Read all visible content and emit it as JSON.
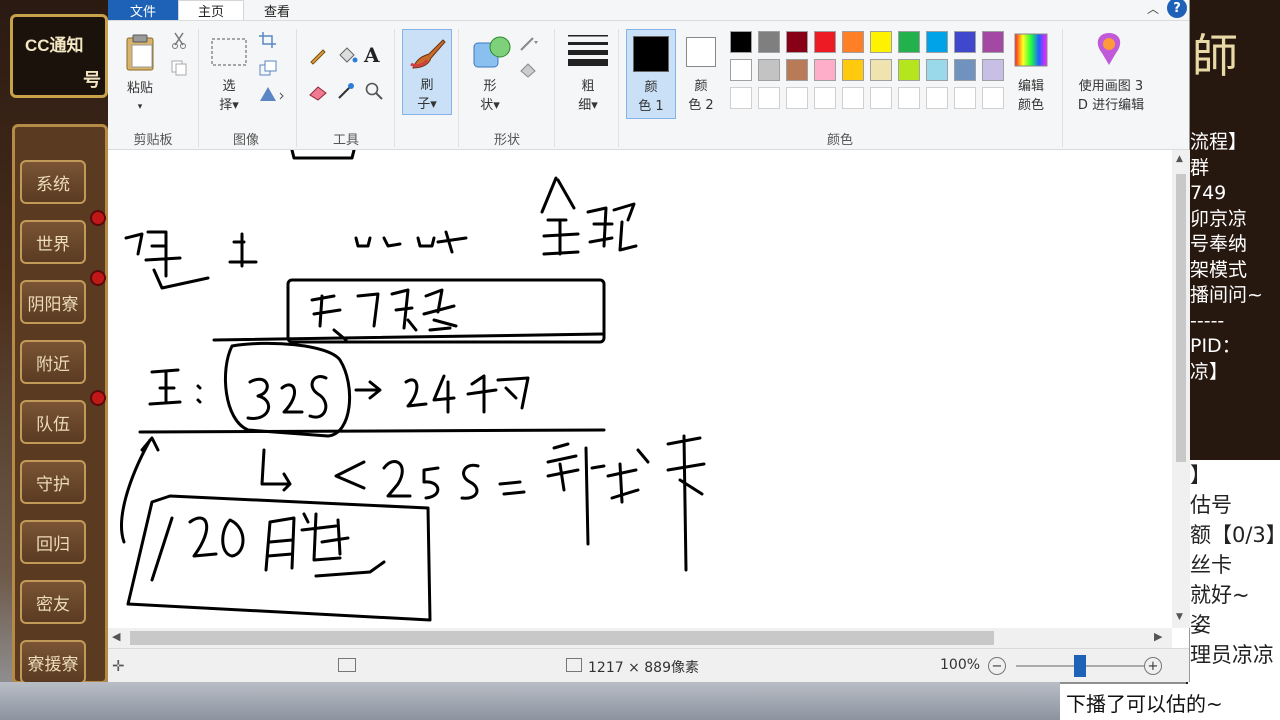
{
  "game": {
    "banner_title": "CC通知",
    "banner_sub": "号",
    "menu": [
      "系统",
      "世界",
      "阴阳寮",
      "附近",
      "队伍",
      "守护",
      "回归",
      "密友",
      "寮援寮"
    ],
    "right_title": "師",
    "right_lines": [
      "流程】",
      "群",
      "749",
      "卯京凉",
      "号奉纳",
      "架模式",
      "播间问~",
      "-----",
      "PID：",
      "凉】"
    ],
    "chat_lines": [
      "】",
      "估号",
      "额【0/3】",
      "丝卡",
      "就好~",
      "姿",
      "理员凉凉"
    ],
    "bottom_tip": "下播了可以估的~"
  },
  "paint": {
    "tabs": {
      "file": "文件",
      "home": "主页",
      "view": "查看"
    },
    "groups": {
      "clipboard": "剪贴板",
      "image": "图像",
      "tools": "工具",
      "shapes": "形状",
      "colors": "颜色"
    },
    "buttons": {
      "paste": [
        "粘贴",
        "▾"
      ],
      "select": [
        "选",
        "择▾"
      ],
      "brush": [
        "刷",
        "子▾"
      ],
      "shape": [
        "形",
        "状▾"
      ],
      "size": [
        "粗",
        "细▾"
      ],
      "color1": [
        "颜",
        "色 1"
      ],
      "color2": [
        "颜",
        "色 2"
      ],
      "edit_colors": [
        "编辑",
        "颜色"
      ],
      "paint3d": [
        "使用画图 3",
        "D 进行编辑"
      ]
    },
    "palette_row1": [
      "#000000",
      "#7f7f7f",
      "#880015",
      "#ed1c24",
      "#ff7f27",
      "#fff200",
      "#22b14c",
      "#00a2e8",
      "#3f48cc",
      "#a349a4"
    ],
    "palette_row2": [
      "#ffffff",
      "#c3c3c3",
      "#b97a57",
      "#ffaec9",
      "#ffc90e",
      "#efe4b0",
      "#b5e61d",
      "#99d9ea",
      "#7092be",
      "#c8bfe7"
    ],
    "color1": "#000000",
    "color2": "#ffffff",
    "status": {
      "dimensions": "1217 × 889像素",
      "zoom": "100%",
      "zoom_level": 0.5
    }
  }
}
